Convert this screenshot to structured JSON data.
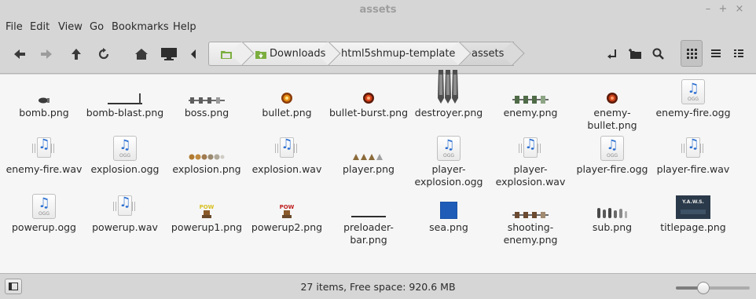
{
  "window": {
    "title": "assets",
    "minimize": "–",
    "maximize": "+",
    "close": "×"
  },
  "menu": [
    "File",
    "Edit",
    "View",
    "Go",
    "Bookmarks",
    "Help"
  ],
  "breadcrumb": [
    "Downloads",
    "html5shmup-template",
    "assets"
  ],
  "files": [
    {
      "name": "bomb.png",
      "icon": "bomb-thumbnail"
    },
    {
      "name": "bomb-blast.png",
      "icon": "blast-thumbnail"
    },
    {
      "name": "boss.png",
      "icon": "boss-thumbnail"
    },
    {
      "name": "bullet.png",
      "icon": "bullet-thumbnail"
    },
    {
      "name": "bullet-burst.png",
      "icon": "burst-thumbnail"
    },
    {
      "name": "destroyer.png",
      "icon": "destroyer-thumbnail"
    },
    {
      "name": "enemy.png",
      "icon": "enemy-thumbnail"
    },
    {
      "name": "enemy-bullet.png",
      "icon": "enemy-bullet-thumbnail"
    },
    {
      "name": "enemy-fire.ogg",
      "icon": "ogg-audio-icon"
    },
    {
      "name": "enemy-fire.wav",
      "icon": "wav-audio-icon"
    },
    {
      "name": "explosion.ogg",
      "icon": "ogg-audio-icon"
    },
    {
      "name": "explosion.png",
      "icon": "explosion-thumbnail"
    },
    {
      "name": "explosion.wav",
      "icon": "wav-audio-icon"
    },
    {
      "name": "player.png",
      "icon": "player-thumbnail"
    },
    {
      "name": "player-explosion.ogg",
      "icon": "ogg-audio-icon"
    },
    {
      "name": "player-explosion.wav",
      "icon": "wav-audio-icon"
    },
    {
      "name": "player-fire.ogg",
      "icon": "ogg-audio-icon"
    },
    {
      "name": "player-fire.wav",
      "icon": "wav-audio-icon"
    },
    {
      "name": "powerup.ogg",
      "icon": "ogg-audio-icon"
    },
    {
      "name": "powerup.wav",
      "icon": "wav-audio-icon"
    },
    {
      "name": "powerup1.png",
      "icon": "powerup1-thumbnail"
    },
    {
      "name": "powerup2.png",
      "icon": "powerup2-thumbnail"
    },
    {
      "name": "preloader-bar.png",
      "icon": "preloader-thumbnail"
    },
    {
      "name": "sea.png",
      "icon": "sea-thumbnail"
    },
    {
      "name": "shooting-enemy.png",
      "icon": "shooting-enemy-thumbnail"
    },
    {
      "name": "sub.png",
      "icon": "sub-thumbnail"
    },
    {
      "name": "titlepage.png",
      "icon": "titlepage-thumbnail"
    }
  ],
  "thumb_text": {
    "ogg": "OGG",
    "pow": "POW",
    "yaws": "Y.A.W.S."
  },
  "status": {
    "text": "27 items, Free space: 920.6 MB",
    "zoom_level": 0.35
  },
  "colors": {
    "accent": "#2b6fd1",
    "sea": "#1e5cb8",
    "window_bg": "#d6d6d6",
    "content_bg": "#f6f6f6"
  }
}
